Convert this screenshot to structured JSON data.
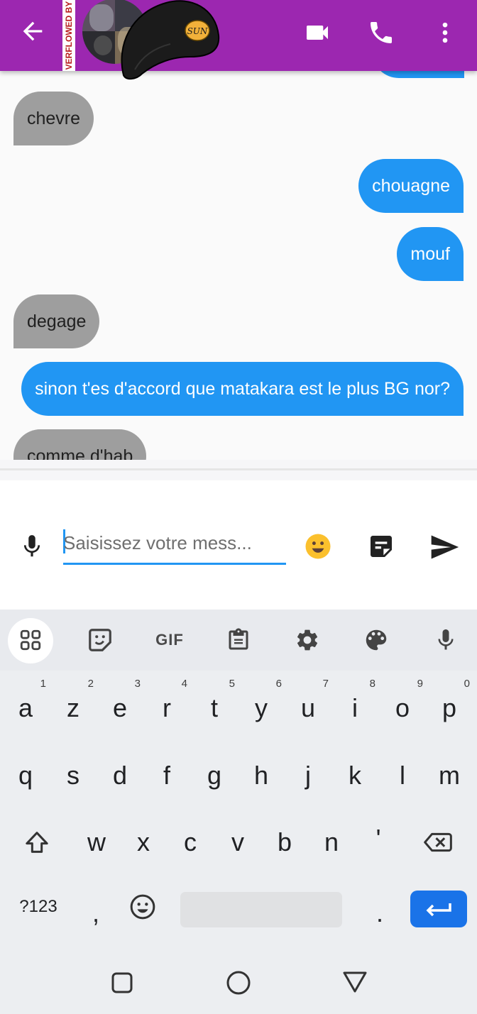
{
  "app_bar": {
    "debug_banner": "VERFLOWED BY",
    "hat_text": "SUN",
    "icons": [
      "back-arrow-icon",
      "video-call-icon",
      "phone-icon",
      "more-vert-icon"
    ],
    "color": "#9c27b0"
  },
  "messages": [
    {
      "direction": "in",
      "text": "chevre"
    },
    {
      "direction": "out",
      "text": "chouagne"
    },
    {
      "direction": "out",
      "text": "mouf"
    },
    {
      "direction": "in",
      "text": "degage"
    },
    {
      "direction": "out",
      "text": "sinon t'es d'accord que matakara est le plus BG nor?"
    },
    {
      "direction": "in",
      "text": "comme d'hab"
    }
  ],
  "composer": {
    "placeholder": "Saisissez votre mess...",
    "value": "",
    "icons": [
      "mic-icon",
      "emoji-icon",
      "sticky-note-icon",
      "send-icon"
    ],
    "accent": "#2196f3"
  },
  "keyboard": {
    "toolbar": {
      "gif_label": "GIF",
      "icons": [
        "apps-grid-icon",
        "sticker-icon",
        "gif-icon",
        "clipboard-icon",
        "settings-icon",
        "palette-icon",
        "mic-icon"
      ]
    },
    "row1": [
      "a",
      "z",
      "e",
      "r",
      "t",
      "y",
      "u",
      "i",
      "o",
      "p"
    ],
    "row1_hints": [
      "1",
      "2",
      "3",
      "4",
      "5",
      "6",
      "7",
      "8",
      "9",
      "0"
    ],
    "row2": [
      "q",
      "s",
      "d",
      "f",
      "g",
      "h",
      "j",
      "k",
      "l",
      "m"
    ],
    "row3": [
      "w",
      "x",
      "c",
      "v",
      "b",
      "n",
      "'"
    ],
    "symbols_label": "?123",
    "comma": ",",
    "period": ".",
    "enter_color": "#1a73e8"
  },
  "nav_bar": {
    "icons": [
      "recents-square-icon",
      "home-circle-icon",
      "back-triangle-icon"
    ]
  }
}
